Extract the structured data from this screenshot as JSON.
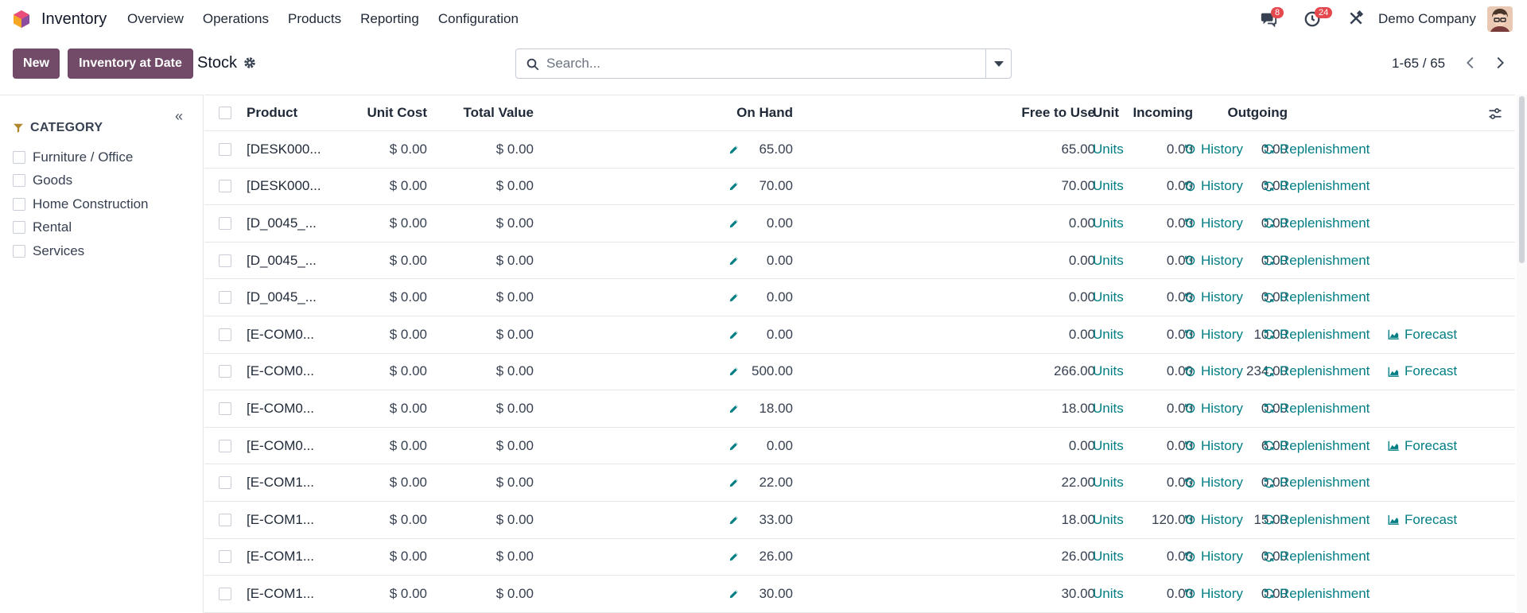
{
  "app": {
    "name": "Inventory"
  },
  "menu": [
    "Overview",
    "Operations",
    "Products",
    "Reporting",
    "Configuration"
  ],
  "systray": {
    "messages_count": "8",
    "activities_count": "24",
    "company": "Demo Company"
  },
  "control": {
    "new_label": "New",
    "inventory_at_date_label": "Inventory at Date",
    "breadcrumb": "Stock",
    "search_placeholder": "Search...",
    "pager": "1-65 / 65"
  },
  "sidebar": {
    "title": "CATEGORY",
    "items": [
      "Furniture / Office",
      "Goods",
      "Home Construction",
      "Rental",
      "Services"
    ]
  },
  "table": {
    "headers": {
      "product": "Product",
      "unit_cost": "Unit Cost",
      "total_value": "Total Value",
      "on_hand": "On Hand",
      "free": "Free to Use",
      "incoming": "Incoming",
      "outgoing": "Outgoing",
      "unit": "Unit"
    },
    "actions": {
      "history": "History",
      "replenishment": "Replenishment",
      "forecast": "Forecast"
    },
    "rows": [
      {
        "product": "[DESK000...",
        "unit_cost": "$ 0.00",
        "total_value": "$ 0.00",
        "on_hand": "65.00",
        "free": "65.00",
        "incoming": "0.00",
        "outgoing": "0.00",
        "unit": "Units",
        "forecast": false
      },
      {
        "product": "[DESK000...",
        "unit_cost": "$ 0.00",
        "total_value": "$ 0.00",
        "on_hand": "70.00",
        "free": "70.00",
        "incoming": "0.00",
        "outgoing": "0.00",
        "unit": "Units",
        "forecast": false
      },
      {
        "product": "[D_0045_...",
        "unit_cost": "$ 0.00",
        "total_value": "$ 0.00",
        "on_hand": "0.00",
        "free": "0.00",
        "incoming": "0.00",
        "outgoing": "0.00",
        "unit": "Units",
        "forecast": false
      },
      {
        "product": "[D_0045_...",
        "unit_cost": "$ 0.00",
        "total_value": "$ 0.00",
        "on_hand": "0.00",
        "free": "0.00",
        "incoming": "0.00",
        "outgoing": "0.00",
        "unit": "Units",
        "forecast": false
      },
      {
        "product": "[D_0045_...",
        "unit_cost": "$ 0.00",
        "total_value": "$ 0.00",
        "on_hand": "0.00",
        "free": "0.00",
        "incoming": "0.00",
        "outgoing": "0.00",
        "unit": "Units",
        "forecast": false
      },
      {
        "product": "[E-COM0...",
        "unit_cost": "$ 0.00",
        "total_value": "$ 0.00",
        "on_hand": "0.00",
        "free": "0.00",
        "incoming": "0.00",
        "outgoing": "10.00",
        "unit": "Units",
        "forecast": true
      },
      {
        "product": "[E-COM0...",
        "unit_cost": "$ 0.00",
        "total_value": "$ 0.00",
        "on_hand": "500.00",
        "free": "266.00",
        "incoming": "0.00",
        "outgoing": "234.00",
        "unit": "Units",
        "forecast": true
      },
      {
        "product": "[E-COM0...",
        "unit_cost": "$ 0.00",
        "total_value": "$ 0.00",
        "on_hand": "18.00",
        "free": "18.00",
        "incoming": "0.00",
        "outgoing": "0.00",
        "unit": "Units",
        "forecast": false
      },
      {
        "product": "[E-COM0...",
        "unit_cost": "$ 0.00",
        "total_value": "$ 0.00",
        "on_hand": "0.00",
        "free": "0.00",
        "incoming": "0.00",
        "outgoing": "6.00",
        "unit": "Units",
        "forecast": true
      },
      {
        "product": "[E-COM1...",
        "unit_cost": "$ 0.00",
        "total_value": "$ 0.00",
        "on_hand": "22.00",
        "free": "22.00",
        "incoming": "0.00",
        "outgoing": "0.00",
        "unit": "Units",
        "forecast": false
      },
      {
        "product": "[E-COM1...",
        "unit_cost": "$ 0.00",
        "total_value": "$ 0.00",
        "on_hand": "33.00",
        "free": "18.00",
        "incoming": "120.00",
        "outgoing": "15.00",
        "unit": "Units",
        "forecast": true
      },
      {
        "product": "[E-COM1...",
        "unit_cost": "$ 0.00",
        "total_value": "$ 0.00",
        "on_hand": "26.00",
        "free": "26.00",
        "incoming": "0.00",
        "outgoing": "0.00",
        "unit": "Units",
        "forecast": false
      },
      {
        "product": "[E-COM1...",
        "unit_cost": "$ 0.00",
        "total_value": "$ 0.00",
        "on_hand": "30.00",
        "free": "30.00",
        "incoming": "0.00",
        "outgoing": "0.00",
        "unit": "Units",
        "forecast": false
      }
    ]
  },
  "colors": {
    "brand": "#714b67",
    "link": "#017e84",
    "badge": "#e5484d"
  },
  "icons": [
    "app-logo-icon",
    "chat-icon",
    "clock-icon",
    "tools-icon",
    "gear-icon",
    "search-icon",
    "caret-down-icon",
    "chevron-left-icon",
    "chevron-right-icon",
    "double-chevron-left-icon",
    "funnel-icon",
    "pencil-icon",
    "history-icon",
    "refresh-icon",
    "area-chart-icon",
    "sliders-icon"
  ]
}
